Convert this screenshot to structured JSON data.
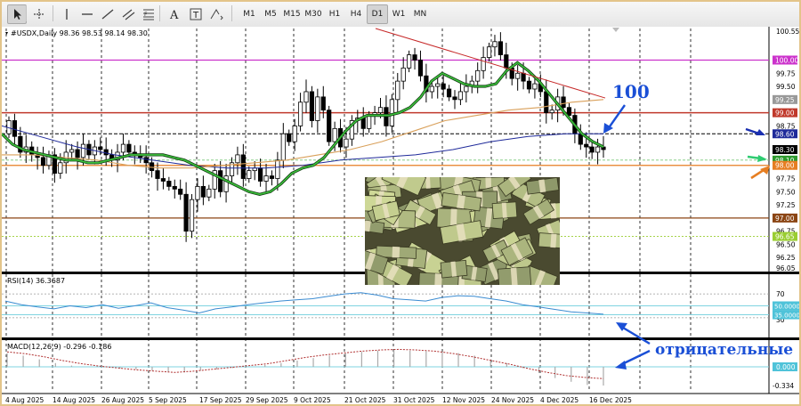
{
  "toolbar": {
    "tools": [
      {
        "name": "cursor-icon",
        "active": true
      },
      {
        "name": "crosshair-icon",
        "active": false
      },
      {
        "name": "vertical-line-icon",
        "active": false
      },
      {
        "name": "horizontal-line-icon",
        "active": false
      },
      {
        "name": "trendline-icon",
        "active": false
      },
      {
        "name": "channel-icon",
        "active": false
      },
      {
        "name": "fibonacci-icon",
        "active": false
      },
      {
        "name": "text-icon",
        "active": false
      },
      {
        "name": "text-label-icon",
        "active": false
      },
      {
        "name": "shapes-icon",
        "active": false
      }
    ],
    "timeframes": [
      "M1",
      "M5",
      "M15",
      "M30",
      "H1",
      "H4",
      "D1",
      "W1",
      "MN"
    ],
    "active_timeframe": "D1"
  },
  "chart_header": {
    "symbol_line": "#USDX,Daily  98.36 98.53 98.14 98.30"
  },
  "colors": {
    "up_candle": "#ffffff",
    "down_candle": "#000000",
    "ma_fast_green": "#2e9a2e",
    "ma_mid_orange": "#d9a05a",
    "ma_slow_blue": "#1f2a9a",
    "resistance_line": "#c62828",
    "level_100": "#cc33cc",
    "level_99": "#c0392b",
    "level_97": "#8b4513",
    "level_98": "#e67e22",
    "current_price_bg": "#000000",
    "rsi_line": "#3a8bd1",
    "macd_signal": "#b03030",
    "annotation_blue": "#1a4fd6"
  },
  "chart_data": [
    {
      "type": "candlestick",
      "title": "#USDX,Daily  98.36 98.53 98.14 98.30",
      "x_labels": [
        "4 Aug 2025",
        "14 Aug 2025",
        "26 Aug 2025",
        "5 Sep 2025",
        "17 Sep 2025",
        "29 Sep 2025",
        "9 Oct 2025",
        "21 Oct 2025",
        "31 Oct 2025",
        "12 Nov 2025",
        "24 Nov 2025",
        "4 Dec 2025",
        "16 Dec 2025"
      ],
      "ylim": [
        96.0,
        100.6
      ],
      "y_ticks": [
        100.55,
        100.0,
        99.75,
        99.5,
        99.25,
        99.0,
        98.75,
        98.6,
        98.3,
        98.1,
        98.0,
        97.75,
        97.5,
        97.25,
        97.0,
        96.75,
        96.65,
        96.5,
        96.25,
        96.05
      ],
      "level_labels": [
        {
          "value": 100.0,
          "label": "100.00",
          "color": "#cc33cc"
        },
        {
          "value": 99.25,
          "label": "99.25",
          "color": "#999999"
        },
        {
          "value": 99.0,
          "label": "99.00",
          "color": "#c0392b"
        },
        {
          "value": 98.6,
          "label": "98.60",
          "color": "#1f2a9a"
        },
        {
          "value": 98.3,
          "label": "98.30",
          "color": "#000000"
        },
        {
          "value": 98.1,
          "label": "98.10",
          "color": "#2e9a2e"
        },
        {
          "value": 98.0,
          "label": "98.00",
          "color": "#e67e22"
        },
        {
          "value": 97.0,
          "label": "97.00",
          "color": "#8b4513"
        },
        {
          "value": 96.65,
          "label": "96.65",
          "color": "#9acd32"
        }
      ],
      "candles_close": [
        98.85,
        98.55,
        98.25,
        98.35,
        98.2,
        98.15,
        98.0,
        98.2,
        97.85,
        98.05,
        98.25,
        98.3,
        98.15,
        98.4,
        98.2,
        98.35,
        98.3,
        98.2,
        98.1,
        98.25,
        98.4,
        98.25,
        98.2,
        98.15,
        98.05,
        97.9,
        97.75,
        97.7,
        97.6,
        97.55,
        97.45,
        96.75,
        97.35,
        97.6,
        97.4,
        97.55,
        97.9,
        97.5,
        97.8,
        98.05,
        98.2,
        97.75,
        97.9,
        97.95,
        97.7,
        97.8,
        97.75,
        98.1,
        98.6,
        98.45,
        98.75,
        99.2,
        99.4,
        98.85,
        99.3,
        99.05,
        98.45,
        98.7,
        98.35,
        98.5,
        98.85,
        98.9,
        98.7,
        98.95,
        99.0,
        99.1,
        98.75,
        99.25,
        99.6,
        99.85,
        100.1,
        100.0,
        99.7,
        99.4,
        99.5,
        99.55,
        99.45,
        99.3,
        99.25,
        99.4,
        99.5,
        99.6,
        99.8,
        100.05,
        100.25,
        100.35,
        100.1,
        99.85,
        99.65,
        99.75,
        99.6,
        99.45,
        99.55,
        99.4,
        99.0,
        99.05,
        99.3,
        99.1,
        98.95,
        98.6,
        98.4,
        98.35,
        98.25,
        98.35,
        98.3
      ],
      "series": [
        {
          "name": "",
          "type": "ma",
          "color": "#2e9a2e",
          "values": [
            98.6,
            98.4,
            98.3,
            98.25,
            98.2,
            98.15,
            98.1,
            98.1,
            98.05,
            98.05,
            98.1,
            98.15,
            98.2,
            98.2,
            98.2,
            98.2,
            98.15,
            98.1,
            98.0,
            97.9,
            97.8,
            97.7,
            97.6,
            97.5,
            97.45,
            97.5,
            97.65,
            97.85,
            97.95,
            98.0,
            98.15,
            98.4,
            98.65,
            98.85,
            98.95,
            98.95,
            98.95,
            99.0,
            99.1,
            99.3,
            99.6,
            99.75,
            99.65,
            99.55,
            99.5,
            99.5,
            99.55,
            99.8,
            99.95,
            99.8,
            99.6,
            99.35,
            99.1,
            98.85,
            98.6,
            98.45,
            98.35
          ]
        },
        {
          "name": "",
          "type": "ma",
          "color": "#d9a05a",
          "values": [
            98.2,
            98.2,
            98.15,
            98.1,
            98.0,
            97.95,
            97.95,
            98.0,
            98.05,
            98.1,
            98.2,
            98.3,
            98.45,
            98.65,
            98.85,
            98.95,
            99.05,
            99.1,
            99.2,
            99.25
          ]
        },
        {
          "name": "",
          "type": "ma",
          "color": "#1f2a9a",
          "values": [
            98.75,
            98.55,
            98.35,
            98.2,
            98.1,
            98.0,
            97.95,
            97.95,
            98.0,
            98.1,
            98.15,
            98.2,
            98.3,
            98.45,
            98.55,
            98.6,
            98.6
          ]
        }
      ],
      "annotations": [
        {
          "text": "100",
          "color": "#1a4fd6"
        }
      ]
    },
    {
      "type": "line",
      "title": "RSI(14) 36.3687",
      "ylim": [
        0,
        100
      ],
      "y_ticks": [
        70,
        50.0,
        35.0,
        30
      ],
      "level_labels": [
        {
          "value": 50,
          "label": "50.0000"
        },
        {
          "value": 35,
          "label": "35.0000"
        }
      ],
      "series": [
        {
          "name": "RSI(14)",
          "values": [
            58,
            52,
            48,
            45,
            50,
            47,
            52,
            46,
            50,
            55,
            47,
            43,
            38,
            45,
            48,
            52,
            55,
            58,
            60,
            62,
            66,
            70,
            72,
            68,
            62,
            60,
            58,
            64,
            67,
            66,
            62,
            58,
            52,
            48,
            44,
            40,
            38,
            36
          ]
        }
      ]
    },
    {
      "type": "bar",
      "title": "MACD(12,26,9) -0.296 -0.186",
      "ylim": [
        -0.4,
        0.4
      ],
      "y_ticks": [
        0.0,
        -0.334
      ],
      "level_labels": [
        {
          "value": 0.0,
          "label": "0.000"
        },
        {
          "value": -0.334,
          "label": "-0.334"
        }
      ],
      "series": [
        {
          "name": "MACD",
          "values": [
            0.22,
            0.18,
            0.12,
            0.06,
            0.02,
            0.0,
            -0.01,
            -0.03,
            -0.04,
            -0.06,
            -0.08,
            -0.09,
            -0.06,
            -0.04,
            -0.02,
            0.0,
            0.03,
            0.06,
            0.1,
            0.14,
            0.18,
            0.22,
            0.24,
            0.26,
            0.27,
            0.26,
            0.25,
            0.24,
            0.22,
            0.18,
            0.12,
            0.06,
            -0.02,
            -0.1,
            -0.18,
            -0.24,
            -0.29,
            -0.3
          ]
        },
        {
          "name": "Signal",
          "values": [
            0.24,
            0.21,
            0.16,
            0.1,
            0.05,
            0.01,
            -0.02,
            -0.05,
            -0.07,
            -0.09,
            -0.07,
            -0.04,
            -0.01,
            0.02,
            0.05,
            0.1,
            0.15,
            0.19,
            0.22,
            0.25,
            0.27,
            0.28,
            0.27,
            0.25,
            0.21,
            0.16,
            0.1,
            0.04,
            -0.03,
            -0.09,
            -0.14,
            -0.17,
            -0.19
          ]
        }
      ]
    }
  ],
  "annotations": {
    "negative_text": "отрицательные"
  }
}
